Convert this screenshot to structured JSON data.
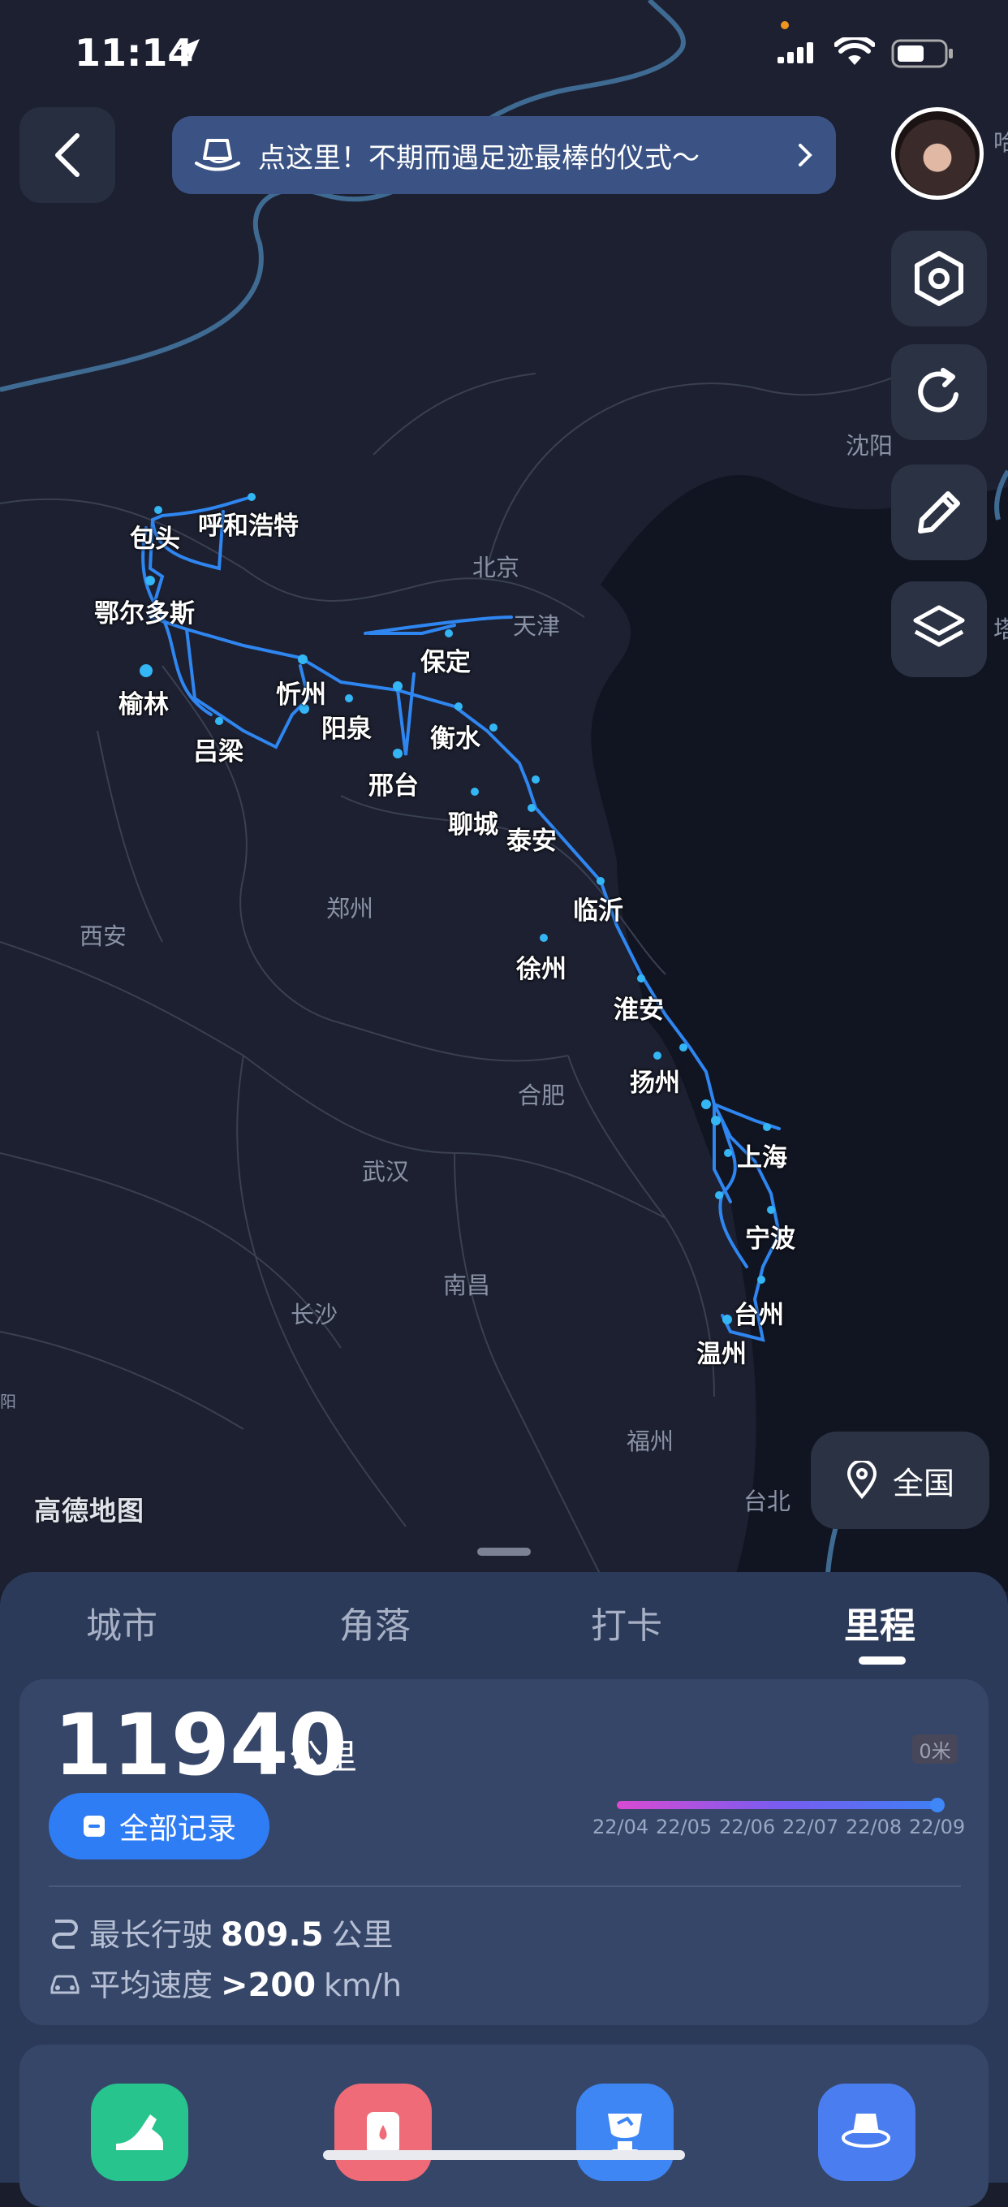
{
  "status_bar": {
    "time": "11:14"
  },
  "banner": {
    "text": "点这里！不期而遇足迹最棒的仪式～"
  },
  "map": {
    "logo": "高德地图",
    "nation_button": "全国",
    "visited_cities": [
      "包头",
      "呼和浩特",
      "鄂尔多斯",
      "榆林",
      "忻州",
      "吕梁",
      "阳泉",
      "保定",
      "衡水",
      "邢台",
      "聊城",
      "泰安",
      "临沂",
      "徐州",
      "淮安",
      "扬州",
      "上海",
      "宁波",
      "台州",
      "温州"
    ],
    "other_cities": [
      "北京",
      "天津",
      "沈阳",
      "西安",
      "郑州",
      "合肥",
      "武汉",
      "南昌",
      "长沙",
      "福州",
      "台北"
    ],
    "edge_labels": [
      "哈",
      "塔",
      "阳"
    ]
  },
  "tabs": [
    {
      "label": "城市",
      "active": false
    },
    {
      "label": "角落",
      "active": false
    },
    {
      "label": "打卡",
      "active": false
    },
    {
      "label": "里程",
      "active": true
    }
  ],
  "mileage": {
    "value": "11940",
    "unit": "公里",
    "all_records": "全部记录",
    "zero_badge": "0米",
    "months": [
      "22/04",
      "22/05",
      "22/06",
      "22/07",
      "22/08",
      "22/09"
    ],
    "longest_label": "最长行驶",
    "longest_value": "809.5",
    "longest_unit": "公里",
    "speed_label": "平均速度",
    "speed_value": ">200",
    "speed_unit": "km/h"
  },
  "icons": {
    "back": "chevron-left-icon",
    "banner": "hat-icon",
    "settings": "hexagon-gear-icon",
    "refresh": "refresh-icon",
    "edit": "pencil-icon",
    "layers": "layers-icon",
    "location": "location-pin-icon",
    "apps": [
      "shoe-icon",
      "fuel-icon",
      "trophy-icon",
      "planet-icon"
    ]
  }
}
